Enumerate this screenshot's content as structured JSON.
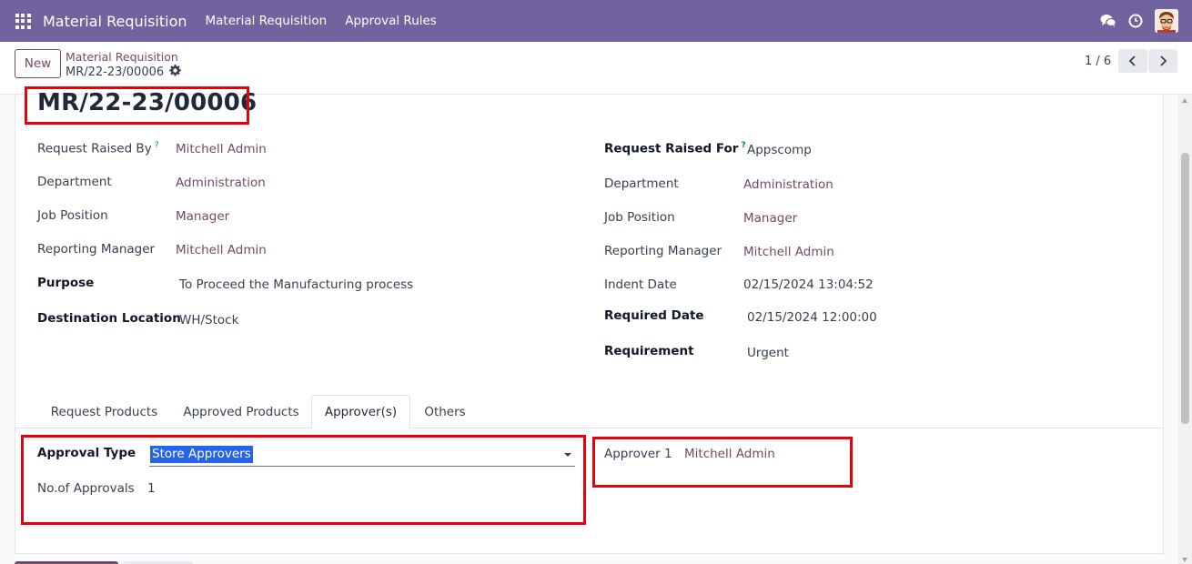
{
  "navbar": {
    "app_title": "Material Requisition",
    "menu": [
      "Material Requisition",
      "Approval Rules"
    ],
    "colors": {
      "navbar": "#71639e",
      "accent": "#714b67",
      "highlight": "#e8000b"
    }
  },
  "control_panel": {
    "new_label": "New",
    "breadcrumb_parent": "Material Requisition",
    "breadcrumb_current": "MR/22-23/00006",
    "pager": "1 / 6"
  },
  "form": {
    "title": "MR/22-23/00006",
    "left": {
      "request_raised_by": {
        "label": "Request Raised By",
        "help": "?",
        "value": "Mitchell Admin"
      },
      "department": {
        "label": "Department",
        "value": "Administration"
      },
      "job_position": {
        "label": "Job Position",
        "value": "Manager"
      },
      "reporting_manager": {
        "label": "Reporting Manager",
        "value": "Mitchell Admin"
      },
      "purpose": {
        "label": "Purpose",
        "value": "To Proceed the Manufacturing process"
      },
      "destination_location": {
        "label": "Destination Location",
        "value": "WH/Stock"
      }
    },
    "right": {
      "request_raised_for": {
        "label": "Request Raised For",
        "help": "?",
        "value": "Appscomp"
      },
      "department": {
        "label": "Department",
        "value": "Administration"
      },
      "job_position": {
        "label": "Job Position",
        "value": "Manager"
      },
      "reporting_manager": {
        "label": "Reporting Manager",
        "value": "Mitchell Admin"
      },
      "indent_date": {
        "label": "Indent Date",
        "value": "02/15/2024 13:04:52"
      },
      "required_date": {
        "label": "Required Date",
        "value": "02/15/2024 12:00:00"
      },
      "requirement": {
        "label": "Requirement",
        "value": "Urgent"
      }
    },
    "tabs": [
      "Request Products",
      "Approved Products",
      "Approver(s)",
      "Others"
    ],
    "active_tab": "Approver(s)",
    "approvers_tab": {
      "approval_type": {
        "label": "Approval Type",
        "value": "Store Approvers"
      },
      "no_of_approvals": {
        "label": "No.of Approvals",
        "value": "1"
      },
      "approver_1": {
        "label": "Approver 1",
        "value": "Mitchell Admin"
      }
    }
  }
}
